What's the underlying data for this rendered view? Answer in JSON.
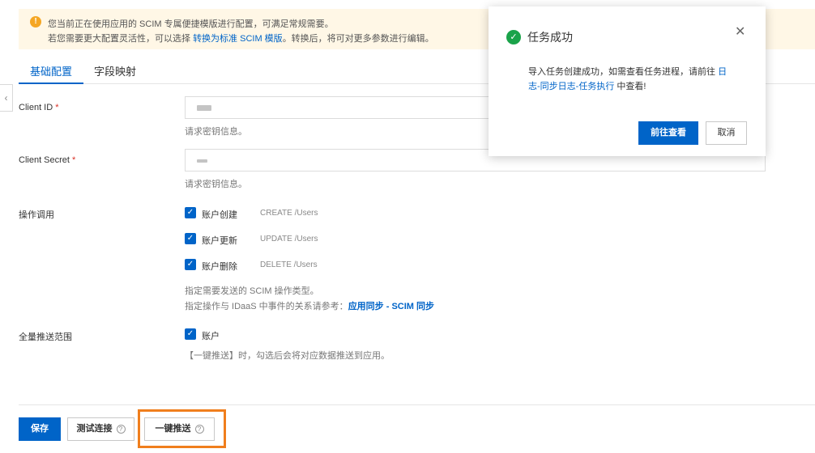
{
  "notice": {
    "line1": "您当前正在使用应用的 SCIM 专属便捷模版进行配置，可满足常规需要。",
    "line2_prefix": "若您需要更大配置灵活性，可以选择",
    "line2_link": "转换为标准 SCIM 模版",
    "line2_suffix": "。转换后，将可对更多参数进行编辑。"
  },
  "tabs": [
    {
      "label": "基础配置",
      "active": true
    },
    {
      "label": "字段映射",
      "active": false
    }
  ],
  "form": {
    "client_id": {
      "label": "Client ID",
      "help": "请求密钥信息。"
    },
    "client_secret": {
      "label": "Client Secret",
      "help": "请求密钥信息。"
    },
    "operations": {
      "label": "操作调用",
      "items": [
        {
          "name": "账户创建",
          "op": "CREATE /Users",
          "checked": true
        },
        {
          "name": "账户更新",
          "op": "UPDATE /Users",
          "checked": true
        },
        {
          "name": "账户删除",
          "op": "DELETE /Users",
          "checked": true
        }
      ],
      "help1": "指定需要发送的 SCIM 操作类型。",
      "help2_prefix": "指定操作与 IDaaS 中事件的关系请参考：",
      "help2_link": "应用同步 - SCIM 同步"
    },
    "scope": {
      "label": "全量推送范围",
      "item": {
        "name": "账户",
        "checked": true
      },
      "help": "【一键推送】时，勾选后会将对应数据推送到应用。"
    }
  },
  "footer": {
    "save": "保存",
    "test": "测试连接",
    "push": "一键推送"
  },
  "modal": {
    "title": "任务成功",
    "msg_prefix": "导入任务创建成功，如需查看任务进程，请前往",
    "msg_link": "日志-同步日志-任务执行",
    "msg_suffix": "中查看!",
    "go": "前往查看",
    "cancel": "取消"
  },
  "icons": {
    "warning": "warning-icon",
    "success": "check-circle-icon",
    "close": "close-icon",
    "help": "question-circle-icon",
    "collapse": "chevron-left-icon"
  },
  "colors": {
    "primary": "#0064c8",
    "success": "#1aa34a",
    "warning": "#f5a623",
    "highlight": "#f07e1d"
  }
}
